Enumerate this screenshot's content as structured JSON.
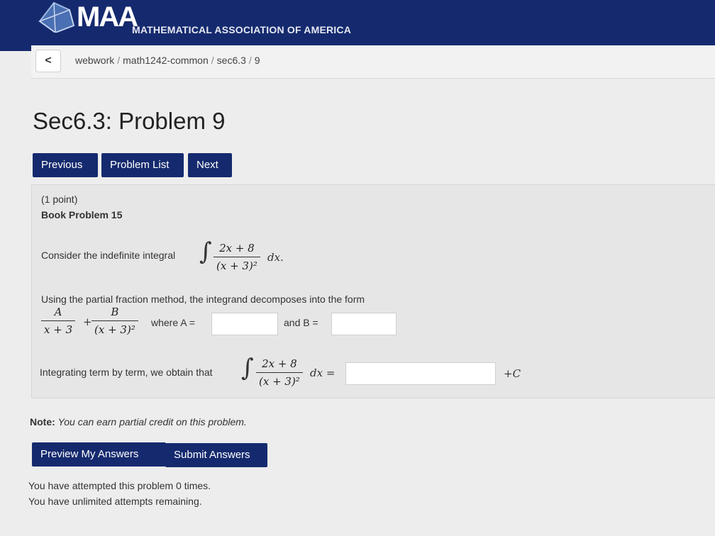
{
  "header": {
    "logo_text": "MAA",
    "logo_subtitle": "MATHEMATICAL ASSOCIATION OF AMERICA"
  },
  "breadcrumb": {
    "back_label": "<",
    "items": [
      "webwork",
      "math1242-common",
      "sec6.3",
      "9"
    ]
  },
  "page_title": "Sec6.3: Problem 9",
  "nav": {
    "previous": "Previous",
    "problem_list": "Problem List",
    "next": "Next"
  },
  "problem": {
    "points": "(1 point)",
    "subtitle": "Book Problem 15",
    "consider_text": "Consider the indefinite integral",
    "integrand_num": "2x + 8",
    "integrand_den": "(x + 3)²",
    "dx": "dx.",
    "partial_text": "Using the partial fraction method, the integrand decomposes into the form",
    "frac_a_num": "A",
    "frac_a_den": "x + 3",
    "plus": "+",
    "frac_b_num": "B",
    "frac_b_den": "(x + 3)²",
    "where_a": "where A =",
    "and_b": "and B =",
    "a_value": "",
    "b_value": "",
    "integrating_text": "Integrating term by term, we obtain that",
    "dx_eq": "dx =",
    "result_value": "",
    "plus_c": "+C"
  },
  "note": {
    "label": "Note:",
    "text": "You can earn partial credit on this problem."
  },
  "actions": {
    "preview": "Preview My Answers",
    "submit": "Submit Answers"
  },
  "footer": {
    "attempts": "You have attempted this problem 0 times.",
    "unlimited": "You have unlimited attempts remaining."
  }
}
